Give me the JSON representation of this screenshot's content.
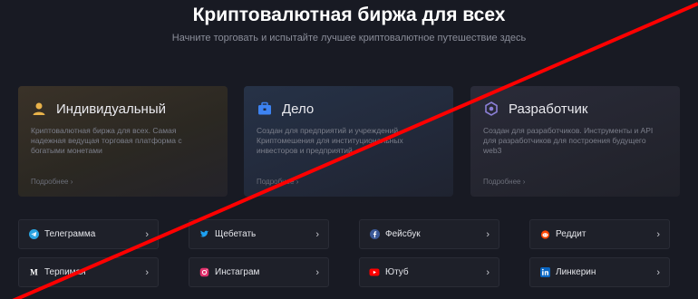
{
  "header": {
    "title": "Криптовалютная биржа для всех",
    "subtitle": "Начните торговать и испытайте лучшее криптовалютное путешествие здесь"
  },
  "cards": [
    {
      "title": "Индивидуальный",
      "desc": "Криптовалютная биржа для всех. Самая надежная ведущая торговая платформа с богатыми монетами",
      "more": "Подробнее ›",
      "icon": "user-icon"
    },
    {
      "title": "Дело",
      "desc": "Создан для предприятий и учреждений. Криптомешения для институциональных инвесторов и предприятий",
      "more": "Подробнее ›",
      "icon": "briefcase-icon"
    },
    {
      "title": "Разработчик",
      "desc": "Создан для разработчиков. Инструменты и API для разработчиков для построения будущего web3",
      "more": "Подробнее ›",
      "icon": "developer-gear-icon"
    }
  ],
  "social": [
    {
      "label": "Телеграмма",
      "icon": "telegram-icon"
    },
    {
      "label": "Щебетать",
      "icon": "twitter-icon"
    },
    {
      "label": "Фейсбук",
      "icon": "facebook-icon"
    },
    {
      "label": "Реддит",
      "icon": "reddit-icon"
    },
    {
      "label": "Терпимая",
      "icon": "medium-icon"
    },
    {
      "label": "Инстаграм",
      "icon": "instagram-icon"
    },
    {
      "label": "Ютуб",
      "icon": "youtube-icon"
    },
    {
      "label": "Линкерин",
      "icon": "linkedin-icon"
    }
  ],
  "chevron": "›",
  "colors": {
    "background": "#181a23",
    "strike_line": "#ff0000",
    "icon_gold": "#e8b24a",
    "icon_blue": "#3d83f2",
    "icon_purple": "#8b7fd6"
  }
}
